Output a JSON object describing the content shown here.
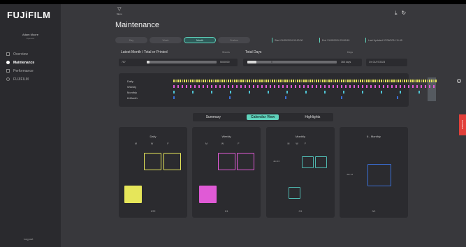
{
  "brand": {
    "logo": "FUJiFILM"
  },
  "user": {
    "name": "Adam Moore",
    "role": "Operator"
  },
  "sidebar": {
    "items": [
      {
        "label": "Overview",
        "icon": "grid-icon",
        "active": false
      },
      {
        "label": "Maintenance",
        "icon": "wrench-icon",
        "active": true
      },
      {
        "label": "Performance",
        "icon": "chart-icon",
        "active": false
      },
      {
        "label": "FUJIFILM",
        "icon": "star-icon",
        "active": false
      }
    ],
    "logout_label": "Log out"
  },
  "header": {
    "menu_label": "Menu",
    "title": "Maintenance",
    "icons": [
      "download-icon",
      "refresh-icon"
    ]
  },
  "period_chips": [
    {
      "label": "Day",
      "active": false
    },
    {
      "label": "Week",
      "active": false
    },
    {
      "label": "Month",
      "active": true
    },
    {
      "label": "Custom",
      "active": false
    }
  ],
  "info": {
    "start": "Start 01/05/2024 00:00:00",
    "end": "End 31/05/2024 23:59:59",
    "last_updated": "Last Updated 07/06/2024 11:45"
  },
  "ranges": {
    "latest": {
      "label": "Latest Month / Total or Printed",
      "unit": "Sheets",
      "min": "767",
      "max": "5000000",
      "fill": 0.04
    },
    "total_days": {
      "label": "Total Days",
      "unit": "Days",
      "min": "0",
      "max": "365 days",
      "fill": 0.1
    },
    "date_input": "On   01/07/2023"
  },
  "timeline": {
    "rows": [
      {
        "label": "Daily",
        "color": "#e6e65a"
      },
      {
        "label": "Weekly",
        "color": "#e05ad6"
      },
      {
        "label": "Monthly",
        "color": "#4fc6d6"
      },
      {
        "label": "6-Month",
        "color": "#3a6fd6"
      }
    ]
  },
  "view_tabs": [
    {
      "label": "Summary",
      "active": false
    },
    {
      "label": "Calendar View",
      "active": true
    },
    {
      "label": "Highlights",
      "active": false
    }
  ],
  "cards": [
    {
      "title": "Daily",
      "days": [
        "M",
        "W",
        "F"
      ],
      "count": "1/22",
      "color": "#e6e65a"
    },
    {
      "title": "Weekly",
      "days": [
        "M",
        "W",
        "F"
      ],
      "count": "1/4",
      "color": "#e05ad6"
    },
    {
      "title": "Monthly",
      "days": [
        "M",
        "W",
        "F"
      ],
      "count": "0/1",
      "color": "#4fb8b0",
      "side_label": "Jan 24"
    },
    {
      "title": "6 - Monthly",
      "days": [],
      "count": "0/1",
      "color": "#3a6fd6",
      "side_label": "Jan 24"
    }
  ],
  "side_tab_label": "Feedback"
}
